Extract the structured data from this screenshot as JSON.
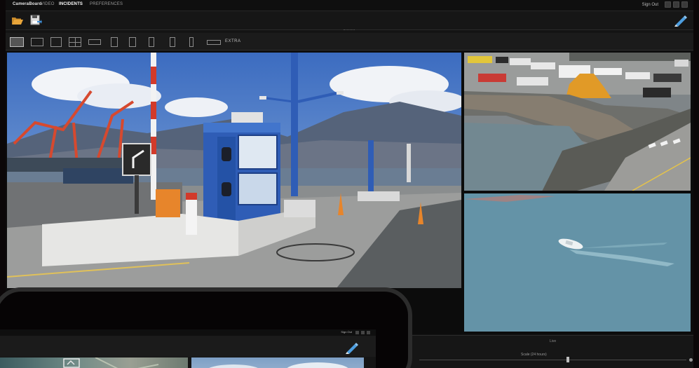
{
  "menu": {
    "brand": "CameraBoard",
    "items": [
      "VIDEO",
      "INCIDENTS",
      "PREFERENCES"
    ],
    "active_index": 1
  },
  "user": {
    "name": "Sign Out"
  },
  "toolbar": {
    "open_icon": "folder-open-icon",
    "save_icon": "save-export-icon",
    "edit_icon": "pencil-icon"
  },
  "layouts": {
    "selected": "1+5",
    "extra_label": "EXTRA"
  },
  "timeline": {
    "label": "Live",
    "zoom_label": "Scale (24 hours)",
    "zoom_value": 0.55
  },
  "laptop": {
    "user": "Sign Out",
    "edit_icon": "pencil-icon"
  },
  "colors": {
    "accent_blue": "#3f8fd8",
    "folder": "#e8a53a",
    "pencil": "#4d9ee0",
    "background": "#141414"
  }
}
